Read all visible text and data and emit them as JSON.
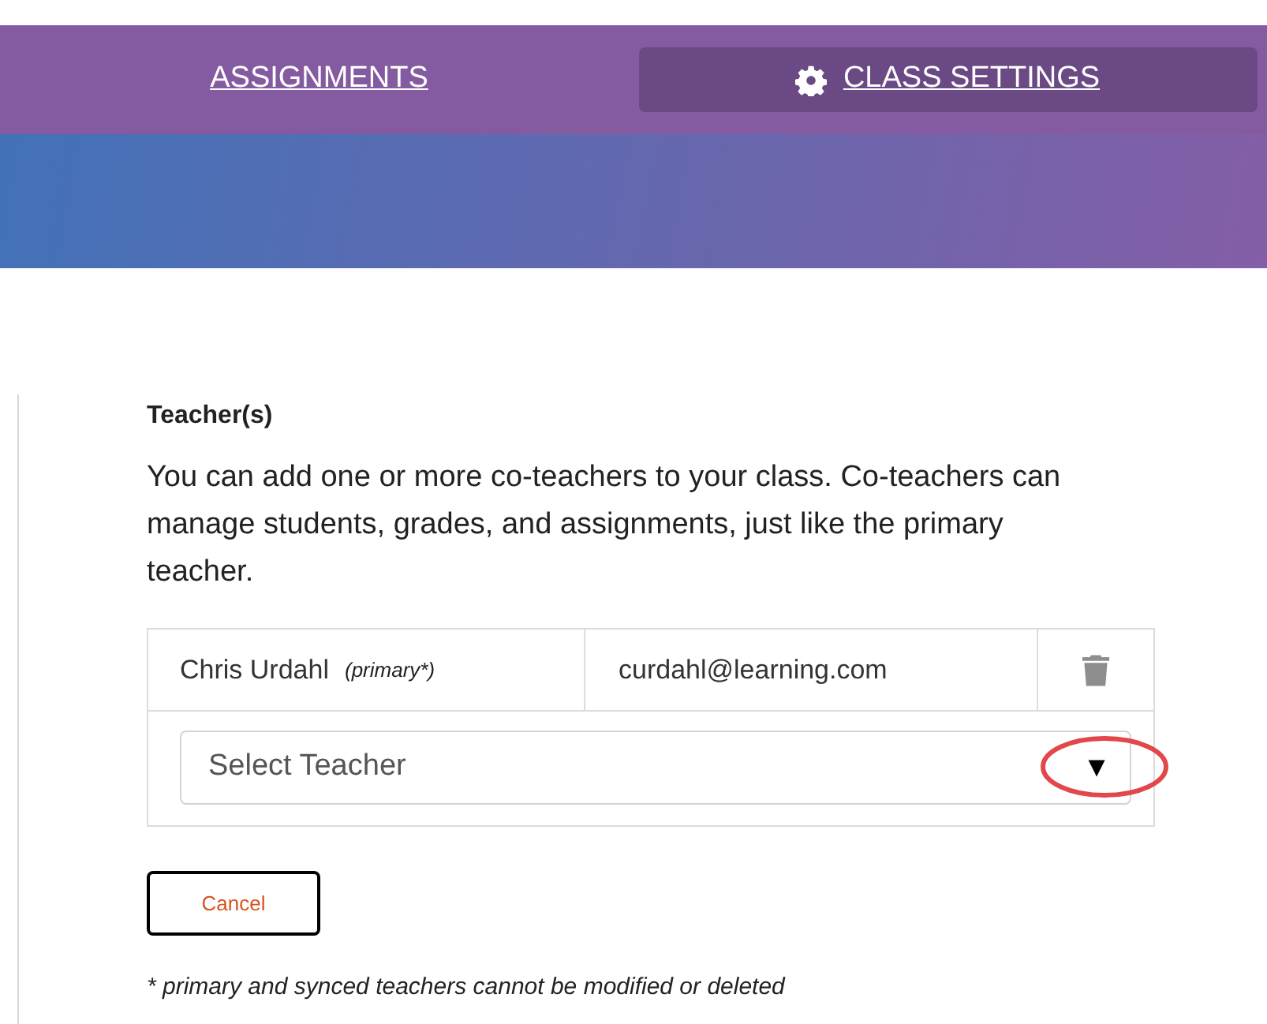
{
  "tabs": [
    {
      "label": "ASSIGNMENTS",
      "selected": false,
      "kind": "text"
    },
    {
      "label": "CLASS SETTINGS",
      "selected": true,
      "kind": "iconed"
    }
  ],
  "section": {
    "title": "Teacher(s)",
    "description": "You can add one or more co-teachers to your class. Co-teachers can manage students, grades, and assignments, just like the primary teacher."
  },
  "teachers": [
    {
      "name": "Chris Urdahl",
      "role": "(primary*)",
      "email": "curdahl@learning.com"
    }
  ],
  "select": {
    "placeholder": "Select Teacher",
    "arrow": "▼",
    "highlighted": true
  },
  "cancel_button": "Cancel",
  "footnote": "* primary and synced teachers cannot be modified or deleted"
}
